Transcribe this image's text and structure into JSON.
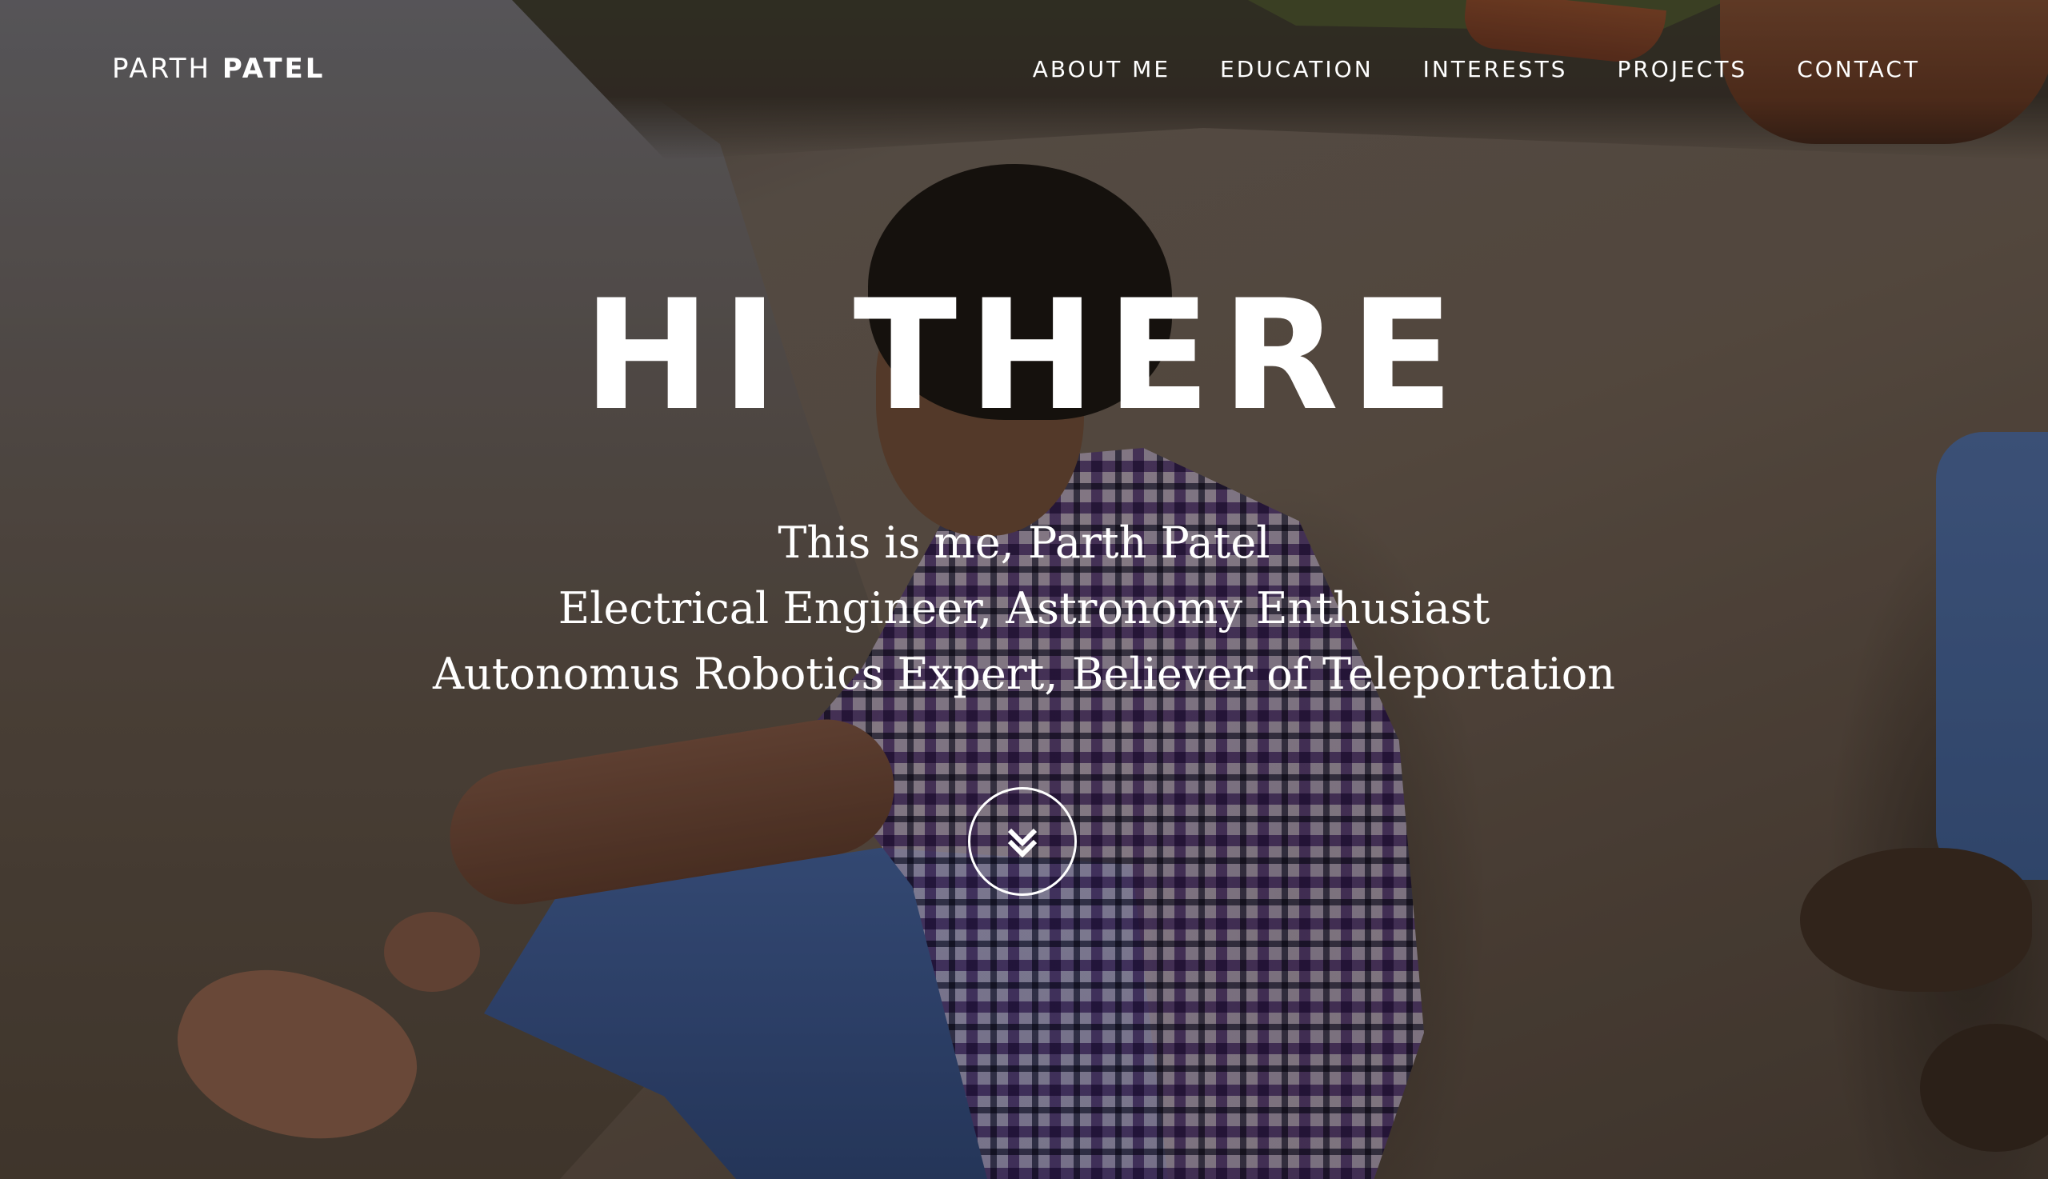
{
  "nav": {
    "brand_first": "PARTH",
    "brand_last": "PATEL",
    "links": [
      "ABOUT ME",
      "EDUCATION",
      "INTERESTS",
      "PROJECTS",
      "CONTACT"
    ]
  },
  "hero": {
    "title": "HI THERE",
    "subtitle_lines": [
      "This is me, Parth Patel",
      "Electrical Engineer, Astronomy Enthusiast",
      "Autonomus Robotics Expert, Believer of Teleportation"
    ],
    "scroll_icon": "double-chevron-down-icon"
  },
  "colors": {
    "text": "#ffffff",
    "overlay": "rgba(20,16,12,0.28)"
  }
}
